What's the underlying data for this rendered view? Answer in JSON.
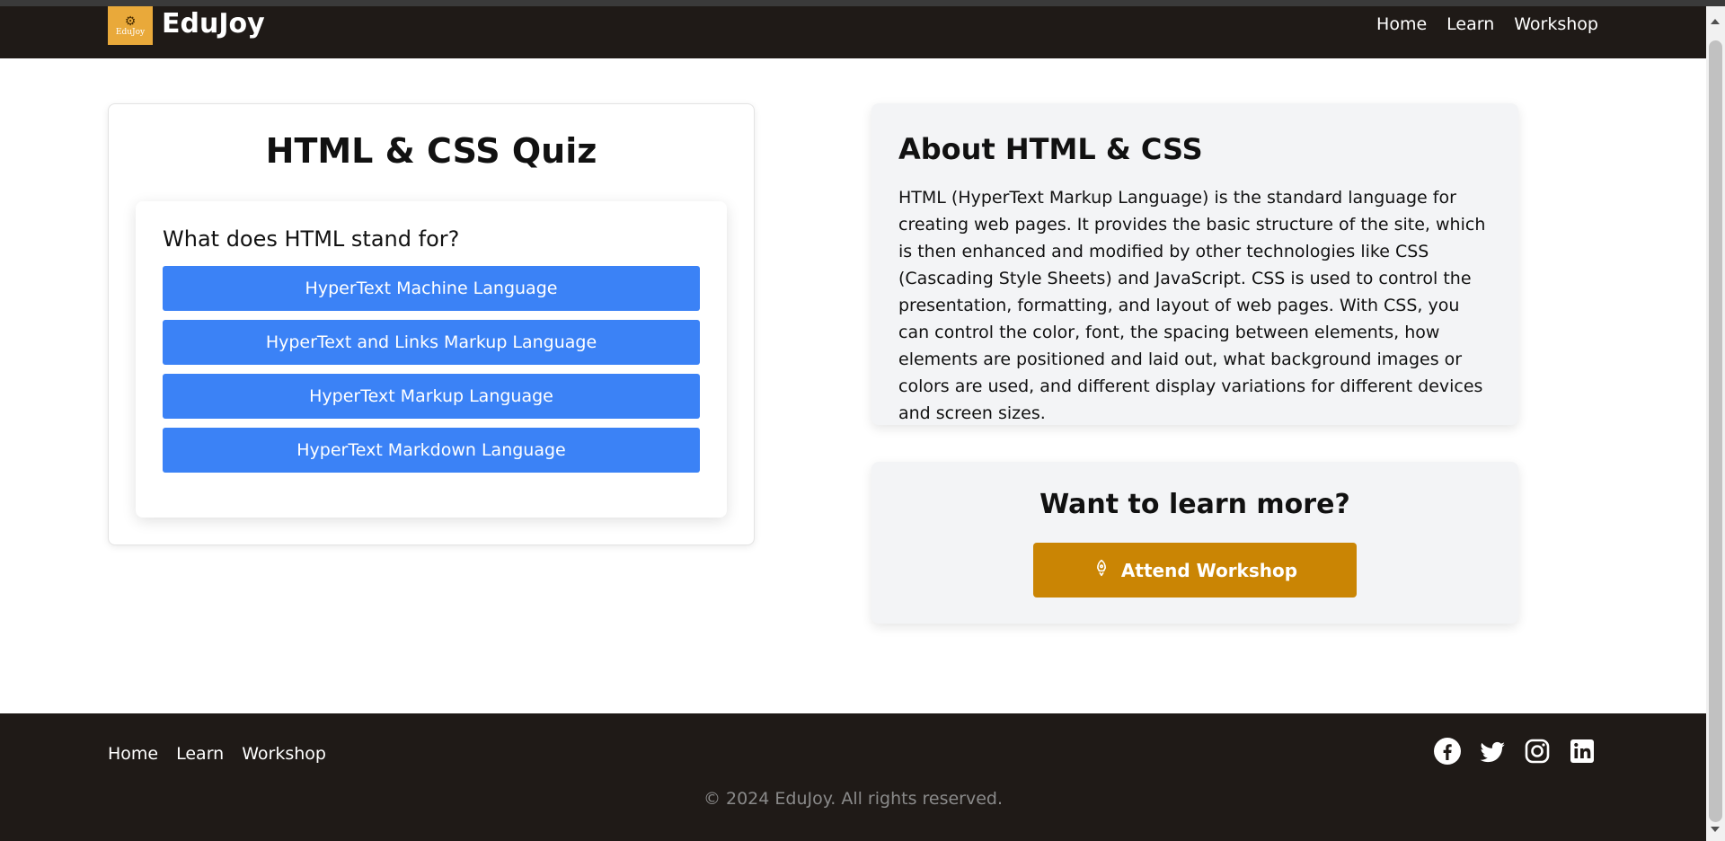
{
  "header": {
    "logo_text": "EduJoy",
    "brand": "EduJoy",
    "nav": [
      "Home",
      "Learn",
      "Workshop"
    ]
  },
  "quiz": {
    "title": "HTML & CSS Quiz",
    "question": "What does HTML stand for?",
    "answers": [
      "HyperText Machine Language",
      "HyperText and Links Markup Language",
      "HyperText Markup Language",
      "HyperText Markdown Language"
    ]
  },
  "about": {
    "title": "About HTML & CSS",
    "text": "HTML (HyperText Markup Language) is the standard language for creating web pages. It provides the basic structure of the site, which is then enhanced and modified by other technologies like CSS (Cascading Style Sheets) and JavaScript. CSS is used to control the presentation, formatting, and layout of web pages. With CSS, you can control the color, font, the spacing between elements, how elements are positioned and laid out, what background images or colors are used, and different display variations for different devices and screen sizes."
  },
  "cta": {
    "title": "Want to learn more?",
    "button_label": "Attend Workshop",
    "button_icon": "rocket-icon"
  },
  "footer": {
    "links": [
      "Home",
      "Learn",
      "Workshop"
    ],
    "social_icons": [
      "facebook-icon",
      "twitter-icon",
      "instagram-icon",
      "linkedin-icon"
    ],
    "copyright": "© 2024 EduJoy. All rights reserved."
  },
  "colors": {
    "nav_bg": "#1f1a17",
    "logo_bg": "#e9a93a",
    "answer_button": "#3b82f6",
    "cta_button": "#ca8504",
    "panel_bg": "#f3f4f6"
  }
}
